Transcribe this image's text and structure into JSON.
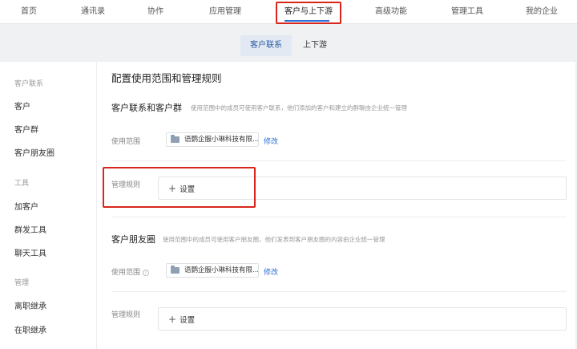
{
  "top_nav": [
    "首页",
    "通讯录",
    "协作",
    "应用管理",
    "客户与上下游",
    "高级功能",
    "管理工具",
    "我的企业"
  ],
  "active_nav": "客户与上下游",
  "sub_tabs": [
    "客户联系",
    "上下游"
  ],
  "sidebar": {
    "group1": "客户联系",
    "group1_items": [
      "客户",
      "客户群",
      "客户朋友圈"
    ],
    "group2": "工具",
    "group2_items": [
      "加客户",
      "群发工具",
      "聊天工具"
    ],
    "group3": "管理",
    "group3_items": [
      "离职继承",
      "在职继承"
    ]
  },
  "main": {
    "title": "配置使用范围和管理规则",
    "section1": {
      "title": "客户联系和客户群",
      "desc": "使用范围中的成员可使用客户联系，他们添加的客户和建立的群聊由企业统一管理",
      "scope_label": "使用范围",
      "scope_value": "语鹦企服小琳科技有限...",
      "edit_label": "修改",
      "rule_label": "管理规则",
      "add_label": "设置"
    },
    "section2": {
      "title": "客户朋友圈",
      "desc": "使用范围中的成员可使用客户朋友圈，他们发表到客户朋友圈的内容由企业统一管理",
      "scope_label": "使用范围",
      "scope_value": "语鹦企服小琳科技有限...",
      "edit_label": "修改",
      "rule_label": "管理规则",
      "add_label": "设置"
    }
  }
}
